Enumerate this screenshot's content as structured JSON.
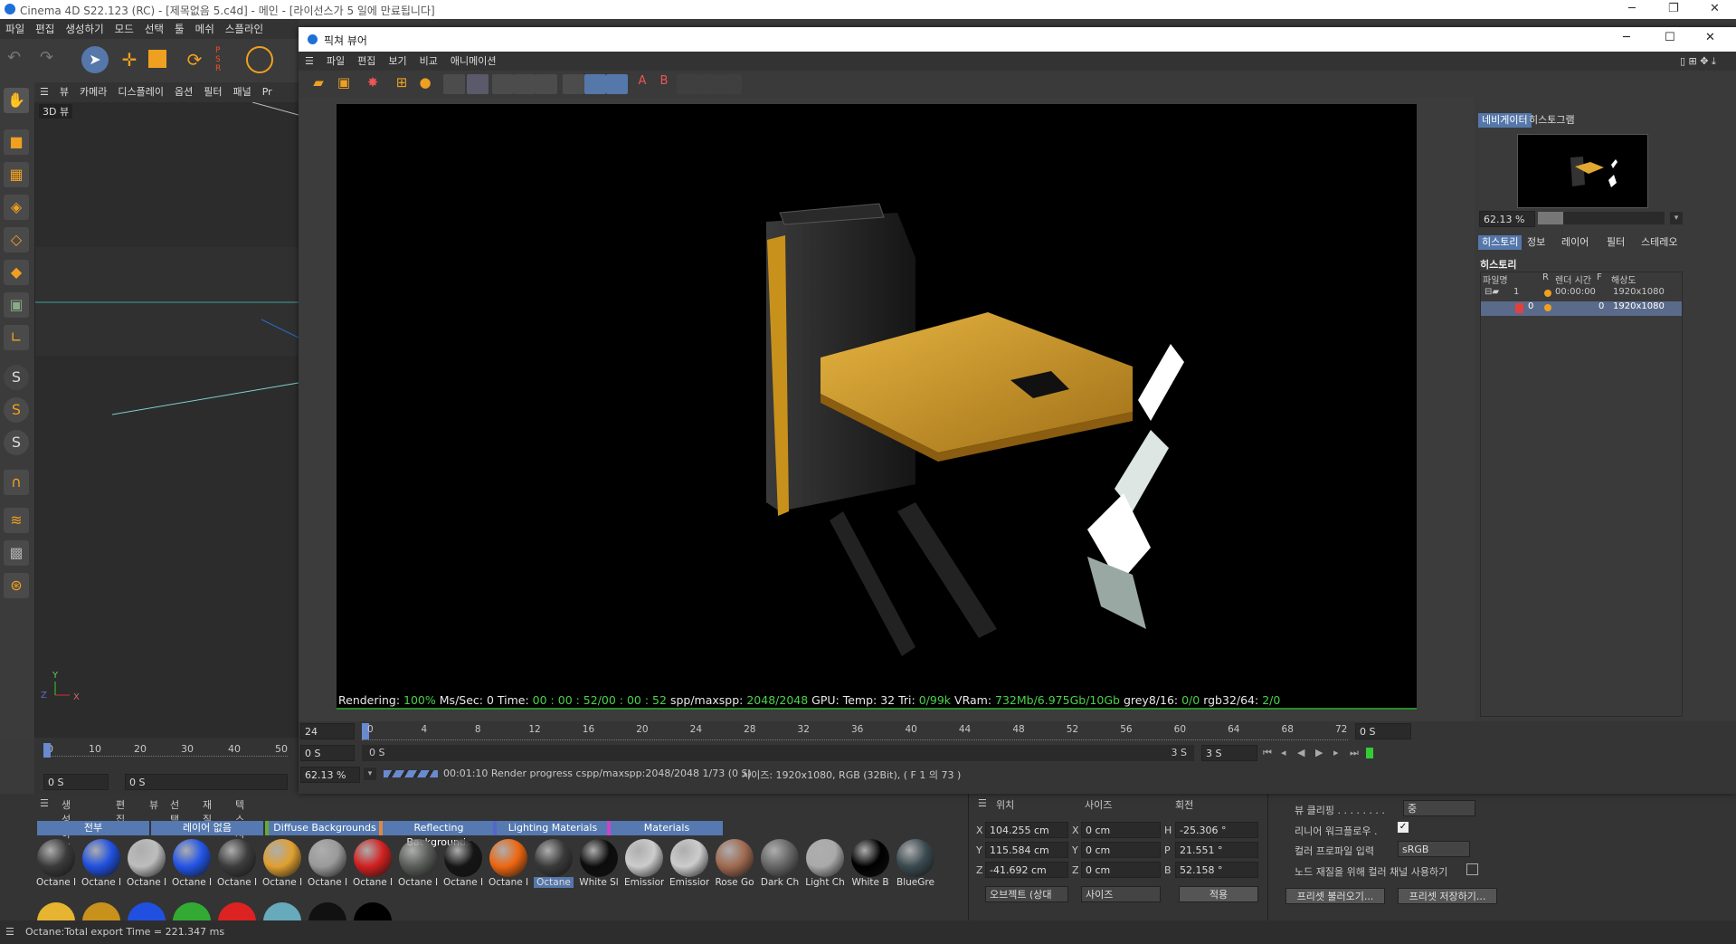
{
  "app": {
    "title": "Cinema 4D S22.123 (RC) - [제목없음 5.c4d] - 메인 - [라이선스가 5 일에 만료됩니다]",
    "menu": [
      "파일",
      "편집",
      "생성하기",
      "모드",
      "선택",
      "툴",
      "메쉬",
      "스플라인"
    ]
  },
  "viewport": {
    "menu": [
      "뷰",
      "카메라",
      "디스플레이",
      "옵션",
      "필터",
      "패널",
      "Pr"
    ],
    "label": "3D 뷰",
    "axis": {
      "y": "Y",
      "z": "Z",
      "x": "X"
    }
  },
  "left_timeline": {
    "ticks": [
      "0",
      "10",
      "20",
      "30",
      "40",
      "50"
    ],
    "start": "0 S",
    "end": "0 S"
  },
  "picture_viewer": {
    "title": "픽쳐 뷰어",
    "menu": [
      "파일",
      "편집",
      "보기",
      "비교",
      "애니메이션"
    ],
    "stats_prefix": "Rendering:",
    "stats_pct": "100%",
    "stats_mid1": "Ms/Sec: 0  Time:",
    "stats_time": "00 : 00 : 52/00 : 00 : 52",
    "stats_mid2": "spp/maxspp:",
    "stats_spp": "2048/2048",
    "stats_mid3": "GPU:    Temp: 32  Tri:",
    "stats_tri": "0/99k",
    "stats_mid4": "VRam:",
    "stats_vram": "732Mb/6.975Gb/10Gb",
    "stats_mid5": "grey8/16:",
    "stats_grey": "0/0",
    "stats_mid6": "rgb32/64:",
    "stats_rgb": "2/0"
  },
  "navigator": {
    "tabs": [
      "네비게이터",
      "히스토그램"
    ],
    "zoom": "62.13 %"
  },
  "history": {
    "tabs": [
      "히스토리",
      "정보",
      "레이어",
      "필터",
      "스테레오"
    ],
    "heading": "히스토리",
    "columns": [
      "파일명",
      "R",
      "렌더 시간",
      "F",
      "해상도"
    ],
    "rows": [
      {
        "name": "1",
        "time": "00:00:00",
        "f": "",
        "res": "1920x1080"
      },
      {
        "name": "0",
        "time": "",
        "f": "0",
        "res": "1920x1080"
      }
    ]
  },
  "pv_timeline": {
    "frame": "24",
    "start": "0 S",
    "ticks": [
      "0",
      "4",
      "8",
      "12",
      "16",
      "20",
      "24",
      "28",
      "32",
      "36",
      "40",
      "44",
      "48",
      "52",
      "56",
      "60",
      "64",
      "68",
      "72"
    ],
    "current": "0 S",
    "range_start": "0 S",
    "range_end": "3 S",
    "end": "3 S",
    "right_field": "0 S",
    "zoom": "62.13 %",
    "progress_text": "00:01:10 Render progress  cspp/maxspp:2048/2048 1/73 (0 S)",
    "size_text": "사이즈: 1920x1080, RGB (32Bit),  ( F 1 의 73 )"
  },
  "material_manager": {
    "menu": [
      "생성하기",
      "편집",
      "뷰",
      "선택",
      "재질",
      "텍스쳐"
    ],
    "tabs": [
      "전부",
      "레이어 없음",
      "Diffuse Backgrounds",
      "Reflecting Backgrounds",
      "Lighting Materials",
      "Materials"
    ],
    "materials": [
      {
        "label": "Octane I",
        "color": "#3a3a3a"
      },
      {
        "label": "Octane I",
        "color": "#2050e0"
      },
      {
        "label": "Octane I",
        "color": "#bdbdbd"
      },
      {
        "label": "Octane I",
        "color": "#2255e8"
      },
      {
        "label": "Octane I",
        "color": "#3c3c3c"
      },
      {
        "label": "Octane I",
        "color": "#e0a030"
      },
      {
        "label": "Octane I",
        "color": "#9a9a9a"
      },
      {
        "label": "Octane I",
        "color": "#d22020"
      },
      {
        "label": "Octane I",
        "color": "#5a5d5a"
      },
      {
        "label": "Octane I",
        "color": "#151515"
      },
      {
        "label": "Octane I",
        "color": "#ee6610"
      },
      {
        "label": "Octane",
        "color": "#3a3a3a"
      },
      {
        "label": "White Sl",
        "color": "#0c0c0c"
      },
      {
        "label": "Emission",
        "color": "#cccccc"
      },
      {
        "label": "Emission",
        "color": "#cccccc"
      },
      {
        "label": "Rose Go",
        "color": "#a06a50"
      },
      {
        "label": "Dark Ch",
        "color": "#666666"
      },
      {
        "label": "Light Ch",
        "color": "#aaaaaa"
      },
      {
        "label": "White B",
        "color": "#000000"
      },
      {
        "label": "BlueGre",
        "color": "#3a4a50"
      }
    ]
  },
  "coords": {
    "headers": [
      "위치",
      "사이즈",
      "회전"
    ],
    "x": {
      "label": "X",
      "pos": "104.255 cm",
      "size_label": "X",
      "size": "0 cm",
      "rot_label": "H",
      "rot": "-25.306 °"
    },
    "y": {
      "label": "Y",
      "pos": "115.584 cm",
      "size_label": "Y",
      "size": "0 cm",
      "rot_label": "P",
      "rot": "21.551 °"
    },
    "z": {
      "label": "Z",
      "pos": "-41.692 cm",
      "size_label": "Z",
      "size": "0 cm",
      "rot_label": "B",
      "rot": "52.158 °"
    },
    "mode": "오브젝트 (상대",
    "size_mode": "사이즈",
    "apply": "적용"
  },
  "view_settings": {
    "view_clipping_label": "뷰 클리핑 . . . . . . . .",
    "view_clipping_value": "중",
    "linear_workflow_label": "리니어 워크플로우 .",
    "color_profile_label": "컬러 프로파일 입력",
    "color_profile_value": "sRGB",
    "node_color_label": "노드 재질을 위해 컬러 채널 사용하기",
    "preset_load": "프리셋 불러오기...",
    "preset_save": "프리셋 저장하기..."
  },
  "status": "Octane:Total export Time = 221.347 ms"
}
